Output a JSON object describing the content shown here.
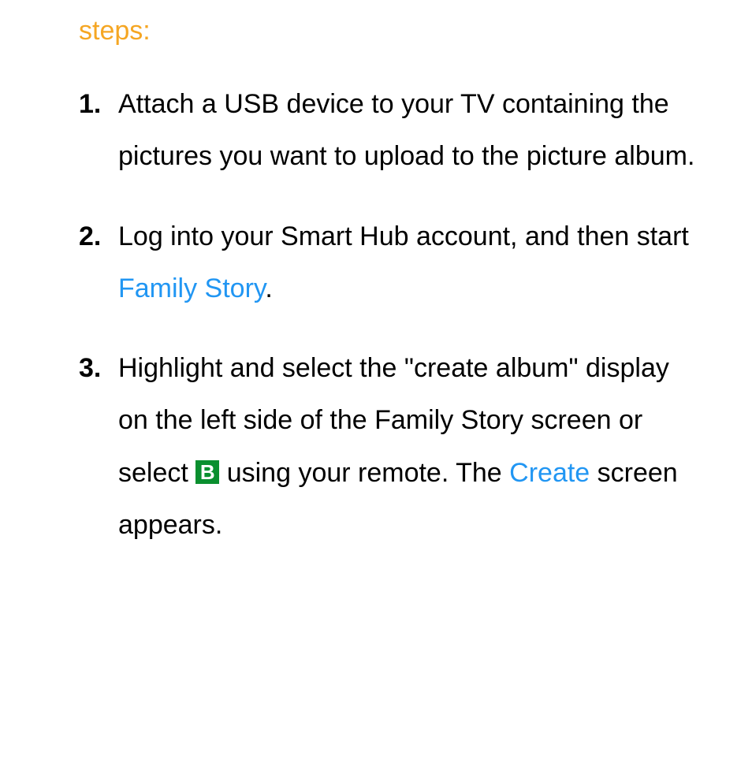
{
  "heading": "steps:",
  "steps": {
    "s1": {
      "text": "Attach a USB device to your TV containing the pictures you want to upload to the picture album."
    },
    "s2": {
      "part1": "Log into your Smart Hub account, and then start ",
      "link": "Family Story",
      "part2": "."
    },
    "s3": {
      "part1": "Highlight and select the \"create album\" display on the left side of the Family Story screen or select ",
      "button_label": "B",
      "part2": " using your remote. The ",
      "link": "Create",
      "part3": " screen appears."
    }
  }
}
